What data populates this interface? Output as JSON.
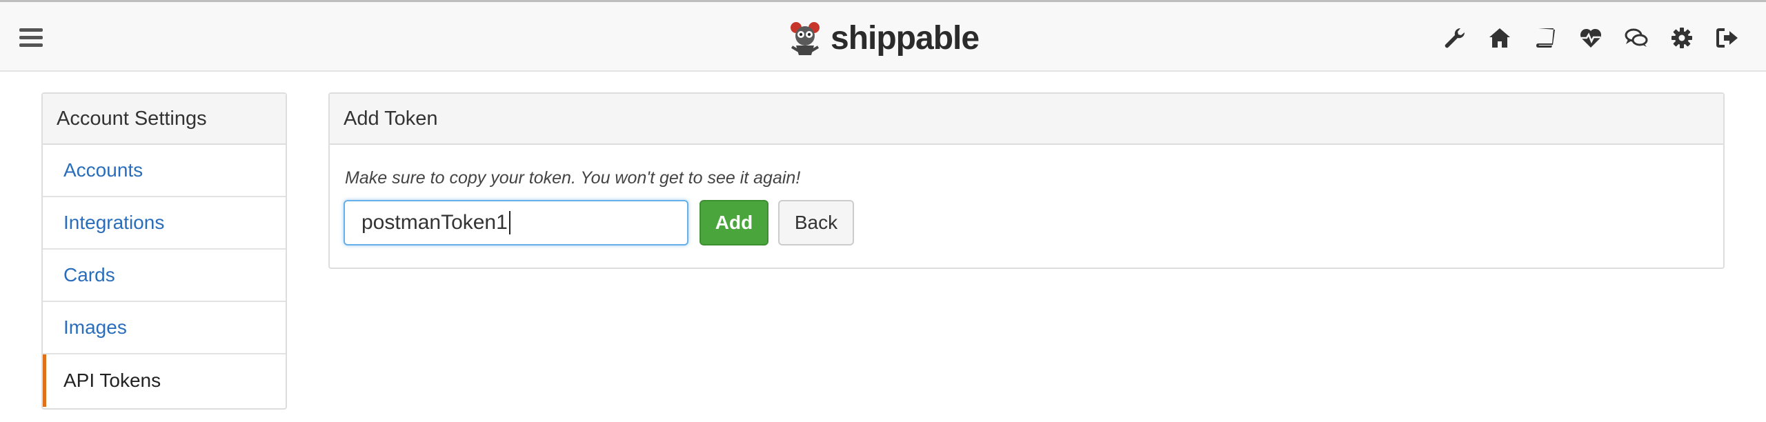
{
  "header": {
    "brand": "shippable",
    "icons": [
      "wrench-icon",
      "home-icon",
      "book-icon",
      "heartbeat-icon",
      "chat-icon",
      "gear-icon",
      "logout-icon"
    ]
  },
  "sidebar": {
    "title": "Account Settings",
    "items": [
      {
        "label": "Accounts"
      },
      {
        "label": "Integrations"
      },
      {
        "label": "Cards"
      },
      {
        "label": "Images"
      },
      {
        "label": "API Tokens",
        "active": true
      }
    ]
  },
  "main": {
    "title": "Add Token",
    "hint": "Make sure to copy your token. You won't get to see it again!",
    "token_input": {
      "value": "postmanToken1"
    },
    "add_label": "Add",
    "back_label": "Back"
  },
  "colors": {
    "link": "#2a6ebb",
    "active_border": "#e0711b",
    "add_button": "#4aa63c",
    "focus_border": "#66afe9"
  }
}
